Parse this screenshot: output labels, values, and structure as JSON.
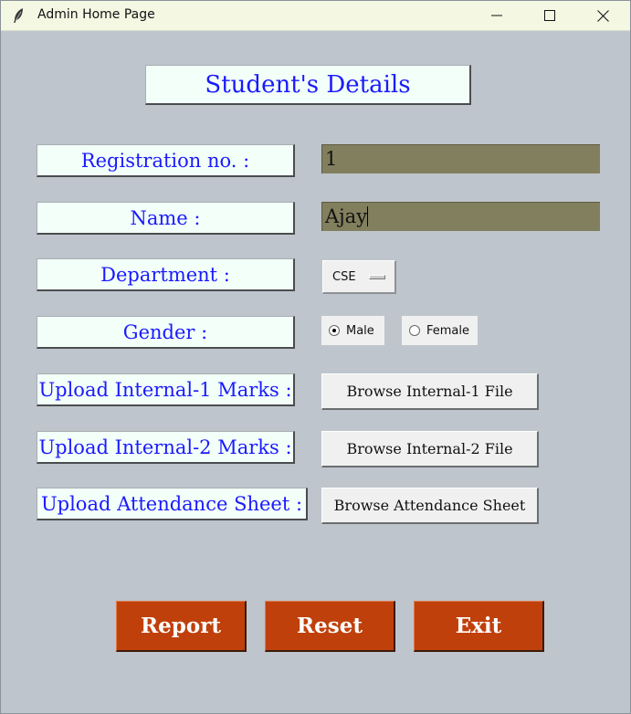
{
  "window": {
    "title": "Admin Home Page",
    "icons": {
      "app": "feather-icon",
      "minimize": "minimize-icon",
      "maximize": "maximize-icon",
      "close": "close-icon"
    }
  },
  "form": {
    "heading": "Student's Details",
    "registration": {
      "label": "Registration no. :",
      "value": "1"
    },
    "name": {
      "label": "Name :",
      "value": "Ajay"
    },
    "department": {
      "label": "Department :",
      "selected": "CSE"
    },
    "gender": {
      "label": "Gender :",
      "options": [
        "Male",
        "Female"
      ],
      "selected": "Male"
    },
    "internal1": {
      "label": "Upload Internal-1 Marks :",
      "button": "Browse Internal-1 File"
    },
    "internal2": {
      "label": "Upload Internal-2 Marks :",
      "button": "Browse Internal-2 File"
    },
    "attendance": {
      "label": "Upload Attendance Sheet :",
      "button": "Browse Attendance Sheet"
    }
  },
  "actions": {
    "report": "Report",
    "reset": "Reset",
    "exit": "Exit"
  },
  "colors": {
    "window_bg": "#bec5cc",
    "label_bg": "#f3fff9",
    "label_text": "#1a1aff",
    "entry_bg": "#827f5e",
    "action_bg": "#c0400b",
    "titlebar_bg": "#f4f8e3"
  }
}
